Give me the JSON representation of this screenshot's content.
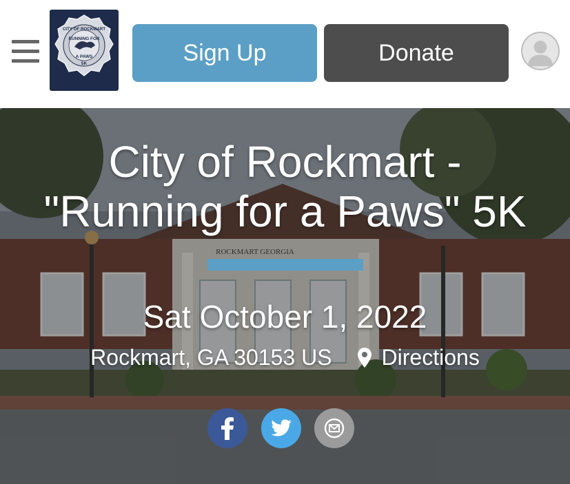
{
  "header": {
    "menu_icon": "hamburger-menu-icon",
    "logo": {
      "top_text": "CITY OF ROCKMART",
      "middle_text": "RUNNING FOR",
      "lower_text": "A PAWS",
      "bottom_text": "5K"
    },
    "signup_label": "Sign Up",
    "donate_label": "Donate",
    "avatar_icon": "user-avatar-icon"
  },
  "hero": {
    "title_line1": "City of Rockmart -",
    "title_line2": "\"Running for a Paws\" 5K",
    "building_sign": "ROCKMART GEORGIA",
    "date": "Sat October 1, 2022",
    "location": "Rockmart, GA 30153 US",
    "directions_label": "Directions",
    "pin_icon": "map-pin-icon"
  },
  "share": {
    "facebook_icon": "facebook-icon",
    "twitter_icon": "twitter-icon",
    "email_icon": "email-icon"
  },
  "colors": {
    "accent": "#5b9fc6",
    "donate": "#4d4d4d",
    "facebook": "#3b5998",
    "twitter": "#4aa8e6",
    "email": "#9b9b9b"
  }
}
